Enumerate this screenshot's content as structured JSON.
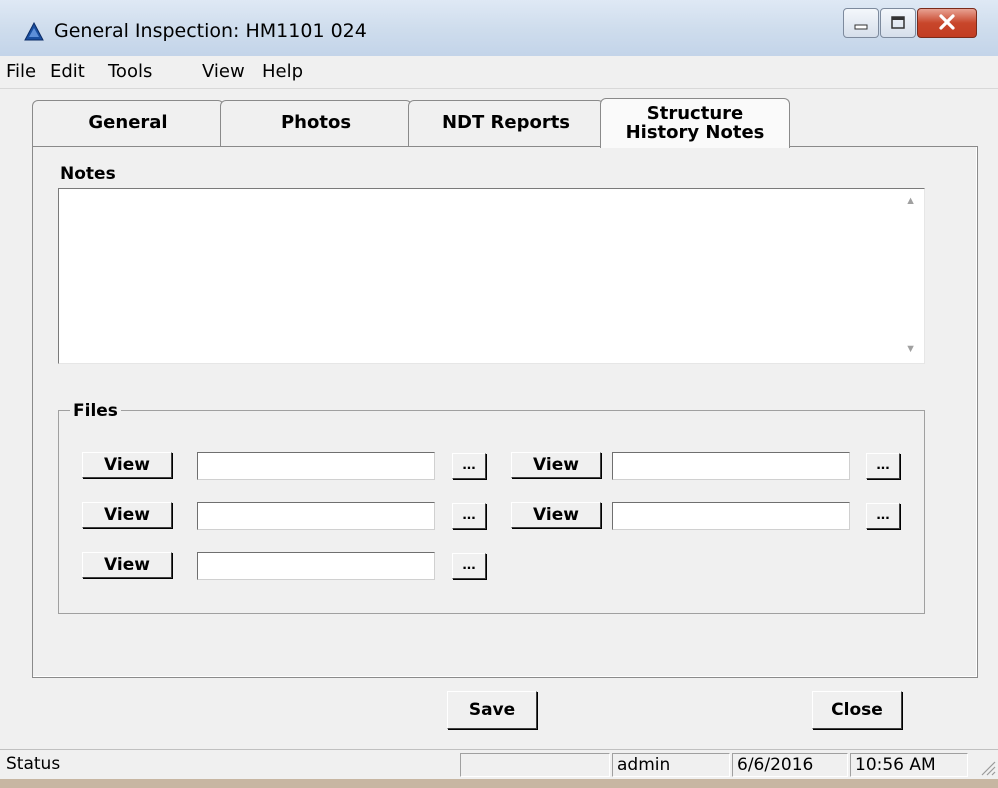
{
  "window": {
    "title": "General Inspection: HM1101 024",
    "icons": {
      "app": "triangle-app-icon",
      "minimize": "minimize-icon",
      "maximize": "maximize-icon",
      "close": "close-icon"
    }
  },
  "menu": [
    "File",
    "Edit",
    "Tools",
    "View",
    "Help"
  ],
  "tabs": [
    {
      "label": "General",
      "active": false
    },
    {
      "label": "Photos",
      "active": false
    },
    {
      "label": "NDT Reports",
      "active": false
    },
    {
      "label": "Structure History Notes",
      "active": true
    }
  ],
  "notes": {
    "label": "Notes",
    "value": ""
  },
  "files": {
    "label": "Files",
    "view_label": "View",
    "browse_label": "...",
    "paths": [
      "",
      "",
      "",
      "",
      ""
    ]
  },
  "actions": {
    "save": "Save",
    "close": "Close"
  },
  "status": {
    "label": "Status",
    "user": "admin",
    "date": "6/6/2016",
    "time": "10:56 AM"
  },
  "colors": {
    "close_button": "#c8462b",
    "title_bar": "#cfdded",
    "panel": "#f0f0f0"
  }
}
